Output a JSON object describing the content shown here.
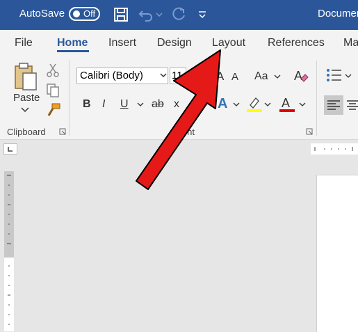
{
  "titlebar": {
    "autosave_label": "AutoSave",
    "toggle_state": "Off",
    "doc_title": "Documen",
    "colors": {
      "bar": "#2b579a",
      "text": "#ffffff"
    }
  },
  "tabs": [
    {
      "label": "File"
    },
    {
      "label": "Home"
    },
    {
      "label": "Insert"
    },
    {
      "label": "Design"
    },
    {
      "label": "Layout"
    },
    {
      "label": "References"
    },
    {
      "label": "Ma"
    }
  ],
  "ribbon": {
    "clipboard": {
      "paste_label": "Paste",
      "group_label": "Clipboard"
    },
    "font": {
      "font_name": "Calibri (Body)",
      "font_size": "11",
      "group_label": "Font",
      "bold": "B",
      "italic": "I",
      "underline": "U",
      "strike": "ab",
      "subscript": "x",
      "superscript": "x",
      "change_case": "Aa",
      "grow": "A",
      "shrink": "A",
      "text_effects": "A",
      "font_color": "A"
    }
  },
  "annotation": {
    "arrow_color": "#e61919"
  }
}
